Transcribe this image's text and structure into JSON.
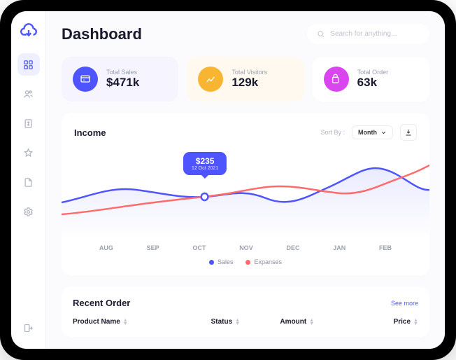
{
  "header": {
    "title": "Dashboard",
    "search_placeholder": "Search for anything..."
  },
  "stats": {
    "sales": {
      "label": "Total Sales",
      "value": "$471k"
    },
    "visitors": {
      "label": "Total Visitors",
      "value": "129k"
    },
    "orders": {
      "label": "Total Order",
      "value": "63k"
    }
  },
  "chart": {
    "title": "Income",
    "sort_label": "Sort By :",
    "sort_value": "Month",
    "tooltip": {
      "value": "$235",
      "date": "12 Oct 2021"
    },
    "legend": {
      "sales": "Sales",
      "expanses": "Expanses"
    },
    "xaxis": [
      "AUG",
      "SEP",
      "OCT",
      "NOV",
      "DEC",
      "JAN",
      "FEB"
    ]
  },
  "chart_data": {
    "type": "line",
    "categories": [
      "AUG",
      "SEP",
      "OCT",
      "NOV",
      "DEC",
      "JAN",
      "FEB"
    ],
    "series": [
      {
        "name": "Sales",
        "values": [
          200,
          220,
          235,
          210,
          230,
          300,
          250
        ]
      },
      {
        "name": "Expanses",
        "values": [
          170,
          185,
          200,
          230,
          235,
          215,
          270
        ]
      }
    ],
    "title": "Income",
    "xlabel": "",
    "ylabel": "",
    "ylim": [
      100,
      320
    ],
    "highlight": {
      "category": "OCT",
      "value": 235,
      "label": "$235",
      "date": "12 Oct 2021"
    }
  },
  "orders": {
    "title": "Recent Order",
    "see_more": "See more",
    "cols": {
      "product": "Product Name",
      "status": "Status",
      "amount": "Amount",
      "price": "Price"
    }
  }
}
